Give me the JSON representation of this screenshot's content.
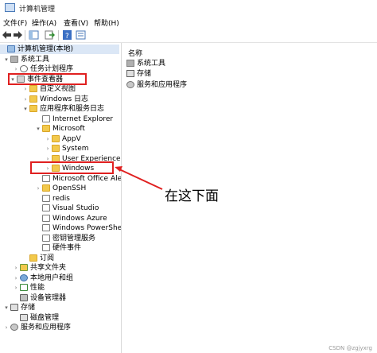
{
  "window": {
    "title": "计算机管理"
  },
  "menu": {
    "file": "文件(F)",
    "action": "操作(A)",
    "view": "查看(V)",
    "help": "帮助(H)"
  },
  "toolbar_icons": [
    "back-arrow-icon",
    "forward-arrow-icon",
    "show-tree-icon",
    "export-icon",
    "help-icon",
    "properties-icon"
  ],
  "tree": {
    "root": "计算机管理(本地)",
    "system_tools": "系统工具",
    "task_scheduler": "任务计划程序",
    "event_viewer": "事件查看器",
    "custom_views": "自定义视图",
    "windows_logs": "Windows 日志",
    "app_service_logs": "应用程序和服务日志",
    "internet_explorer": "Internet Explorer",
    "microsoft": "Microsoft",
    "appv": "AppV",
    "system": "System",
    "user_experience": "User Experience Vir",
    "windows": "Windows",
    "office_alerts": "Microsoft Office Alerts",
    "openssh": "OpenSSH",
    "redis": "redis",
    "visual_studio": "Visual Studio",
    "windows_azure": "Windows Azure",
    "windows_powershell": "Windows PowerShell",
    "key_mgmt": "密钥管理服务",
    "hardware_events": "硬件事件",
    "subscriptions": "订阅",
    "shared_folders": "共享文件夹",
    "local_users": "本地用户和组",
    "performance": "性能",
    "device_manager": "设备管理器",
    "storage": "存储",
    "disk_mgmt": "磁盘管理",
    "services_apps": "服务和应用程序"
  },
  "right": {
    "header": "名称",
    "items": [
      "系统工具",
      "存储",
      "服务和应用程序"
    ]
  },
  "annotation": {
    "text": "在这下面",
    "color": "#e02020"
  },
  "watermark": "CSDN @zgjyxrg"
}
